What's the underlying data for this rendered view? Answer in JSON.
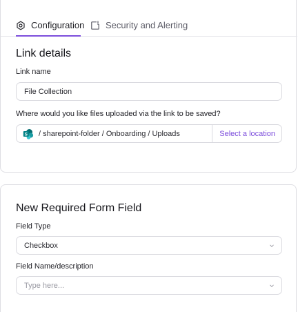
{
  "tabs": {
    "configuration": "Configuration",
    "security": "Security and Alerting"
  },
  "link_details": {
    "heading": "Link details",
    "name_label": "Link name",
    "name_value": "File Collection",
    "location_question": "Where would you like files uploaded via the link to be saved?",
    "location_path": "/ sharepoint-folder / Onboarding / Uploads",
    "select_location": "Select a location"
  },
  "form_field": {
    "heading": "New Required Form Field",
    "type_label": "Field Type",
    "type_value": "Checkbox",
    "name_label": "Field Name/description",
    "name_placeholder": "Type here..."
  },
  "colors": {
    "accent": "#7c4ddc",
    "sharepoint": "#038387"
  },
  "icons": {
    "config_tab": "settings-hexagon-icon",
    "security_tab": "alert-window-icon",
    "location": "sharepoint-icon",
    "dropdown": "chevron-down-icon"
  }
}
